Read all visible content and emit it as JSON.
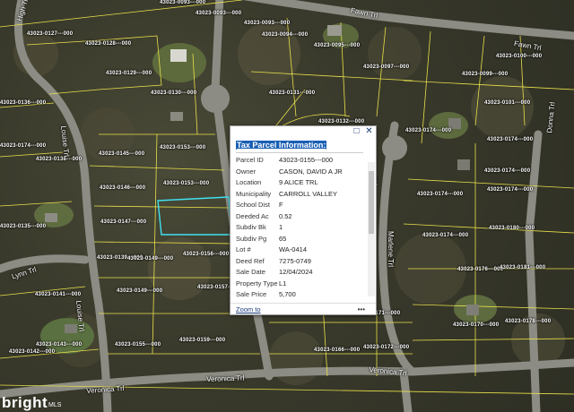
{
  "map": {
    "parcel_labels": [
      "43023-0093---000",
      "43023-0093---000",
      "43023-0093---000",
      "43023-0127---000",
      "43023-0128---000",
      "43023-0094---000",
      "43023-0095---000",
      "43023-0129---000",
      "43023-0097---000",
      "43023-0100---000",
      "43023-0130---000",
      "43023-0131---000",
      "43023-0099---000",
      "43023-0101---000",
      "43023-0136---000",
      "43023-0132---000",
      "43023-0174---000",
      "43023-0174---000",
      "43023-0153---000",
      "43023-0145---000",
      "43023-0138---000",
      "43023-0174---000",
      "43023-0146---000",
      "43023-0153---000",
      "43023-0174---000",
      "43023-0174---000",
      "43023-0135---000",
      "43023-0147---000",
      "43023-0174---000",
      "43023-0180---000",
      "43023-0139---000",
      "43023-0149---000",
      "43023-0156---000",
      "43023-0176---000",
      "43023-0181---000",
      "43023-0141---000",
      "43023-0149---000",
      "43023-0157---000",
      "43023-0143---000",
      "43023-0155---000",
      "43023-0159---000",
      "43023-0166---000",
      "43023-0172---000",
      "43023-0170---000",
      "43023-0178---000",
      "43023-0142---000",
      "43023-0171---000",
      "43023-0174---000"
    ],
    "road_labels": [
      "High Trl",
      "Fawn Trl",
      "Fawn Trl",
      "Louise Trl",
      "Donna Trl",
      "Lynn Trl",
      "Louise Trl",
      "Marlene Trl",
      "Marlene Trl",
      "Veronica Trl",
      "Veronica Trl",
      "Veronica Trl"
    ]
  },
  "popup": {
    "title": "Tax Parcel Information:",
    "rows": [
      {
        "key": "Parcel ID",
        "value": "43023-0155---000"
      },
      {
        "key": "Owner",
        "value": "CASON, DAVID A JR"
      },
      {
        "key": "Location",
        "value": "9 ALICE TRL"
      },
      {
        "key": "Municipality",
        "value": "CARROLL VALLEY"
      },
      {
        "key": "School Dist",
        "value": "F"
      },
      {
        "key": "Deeded Ac",
        "value": "0.52"
      },
      {
        "key": "Subdiv Bk",
        "value": "1"
      },
      {
        "key": "Subdiv Pg",
        "value": "65"
      },
      {
        "key": "Lot #",
        "value": "WA-0414"
      },
      {
        "key": "Deed Ref",
        "value": "7275-0749"
      },
      {
        "key": "Sale Date",
        "value": "12/04/2024"
      },
      {
        "key": "Property Type",
        "value": "L1"
      },
      {
        "key": "Sale Price",
        "value": "5,700"
      }
    ],
    "zoom_label": "Zoom to",
    "more_label": "•••",
    "max_icon": "□",
    "close_icon": "✕"
  },
  "brand": {
    "logo": "bright",
    "sub": "MLS"
  },
  "colors": {
    "parcel_line": "#e8e04a",
    "selected_parcel": "#40e0f0",
    "road": "#8c8c84"
  }
}
